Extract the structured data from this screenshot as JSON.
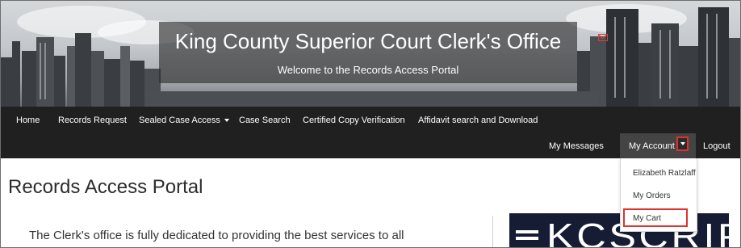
{
  "banner": {
    "title": "King County Superior Court Clerk's Office",
    "subtitle": "Welcome to the Records Access Portal"
  },
  "nav": {
    "items": [
      {
        "label": "Home"
      },
      {
        "label": "Records Request"
      },
      {
        "label": "Sealed Case Access",
        "dropdown": true
      },
      {
        "label": "Case Search"
      },
      {
        "label": "Certified Copy Verification"
      },
      {
        "label": "Affidavit search and Download"
      }
    ],
    "right": {
      "messages": "My Messages",
      "messages_icon": "envelope-icon",
      "account": "My Account",
      "logout": "Logout"
    }
  },
  "account_menu": {
    "items": [
      "Elizabeth Ratzlaff",
      "My Orders",
      "My Cart"
    ],
    "highlighted": "My Cart"
  },
  "main": {
    "heading": "Records Access Portal",
    "intro": "The Clerk's office is fully dedicated to providing the best services to all"
  },
  "sidebar_logo": {
    "text": "KCSCRIPT"
  },
  "colors": {
    "navbar": "#202020",
    "highlight_box": "#e03131",
    "logo_bg": "#161c34"
  }
}
